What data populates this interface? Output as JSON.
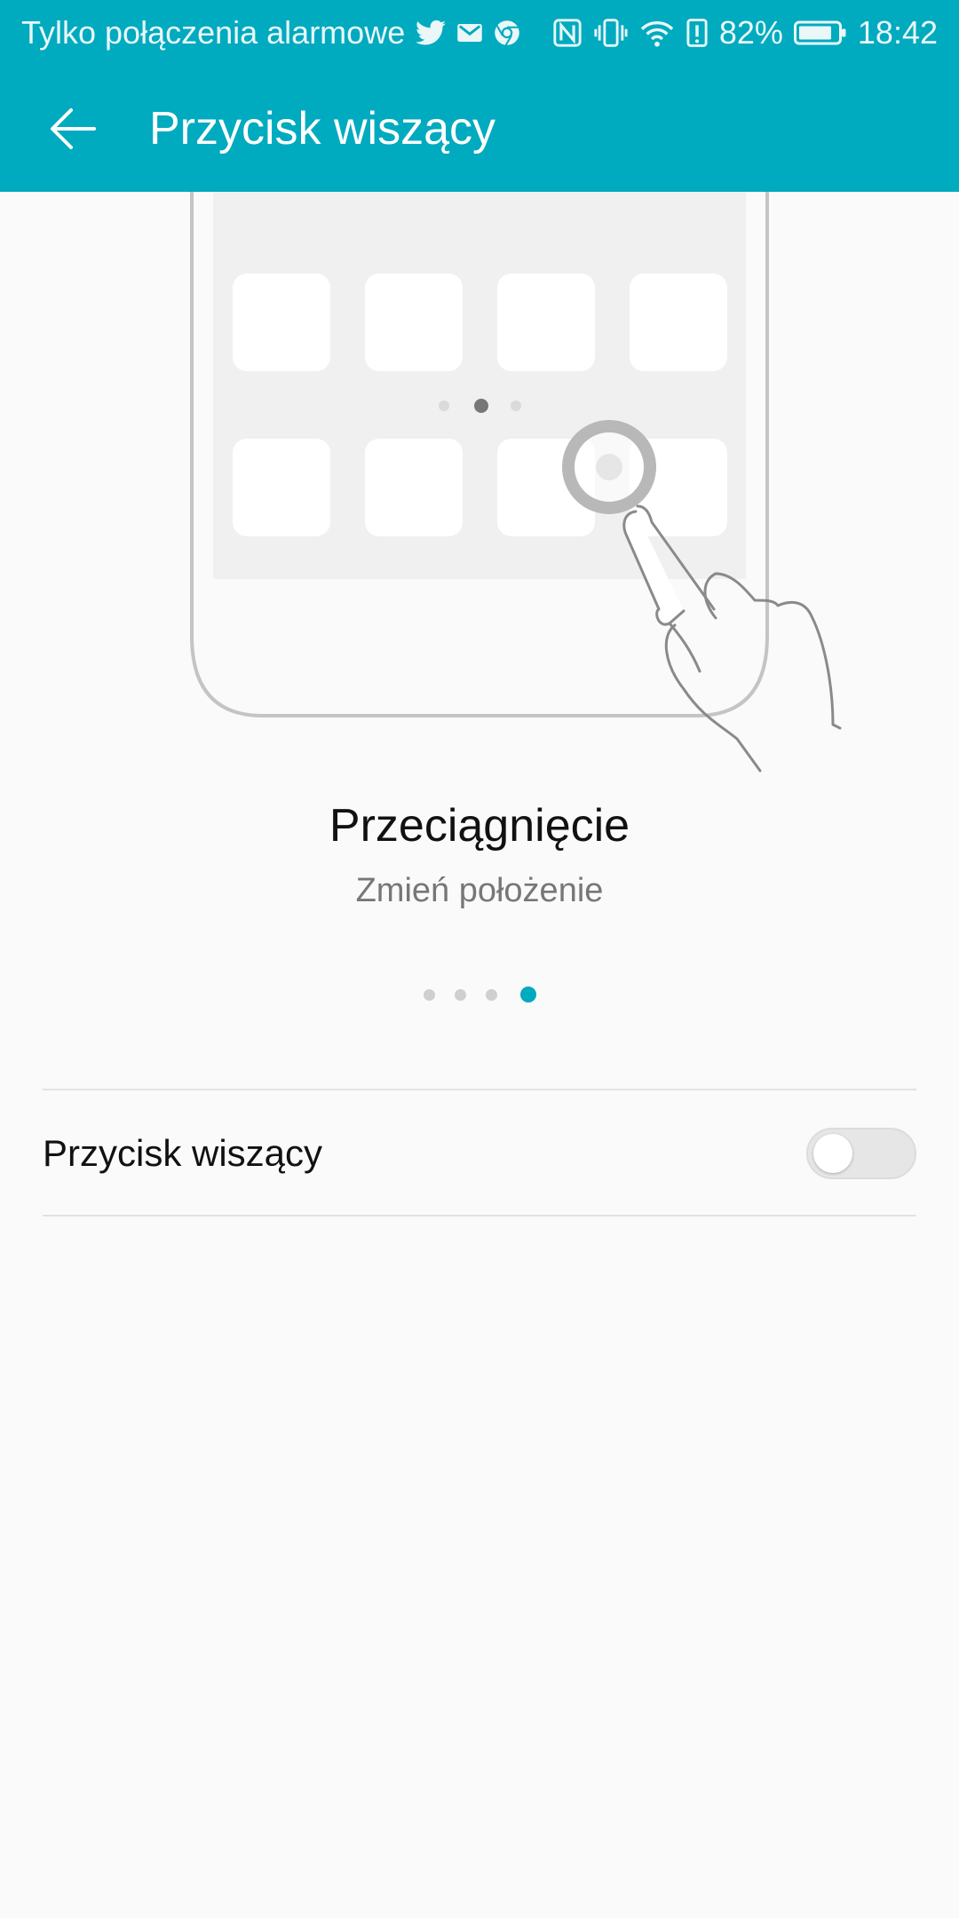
{
  "status_bar": {
    "carrier_text": "Tylko połączenia alarmowe",
    "notification_icons": [
      "twitter-icon",
      "gmail-icon",
      "chrome-icon"
    ],
    "system_icons": [
      "nfc-icon",
      "vibrate-icon",
      "wifi-icon",
      "battery-alert-icon",
      "battery-icon"
    ],
    "battery_percent": "82%",
    "time": "18:42"
  },
  "toolbar": {
    "title": "Przycisk wiszący",
    "back_icon": "arrow-left-icon"
  },
  "tutorial": {
    "title": "Przeciągnięcie",
    "subtitle": "Zmień położenie",
    "page_count": 4,
    "active_page": 4
  },
  "setting": {
    "label": "Przycisk wiszący",
    "enabled": false
  },
  "colors": {
    "accent": "#00aabf",
    "background": "#fafafa",
    "divider": "#e2e2e2"
  }
}
